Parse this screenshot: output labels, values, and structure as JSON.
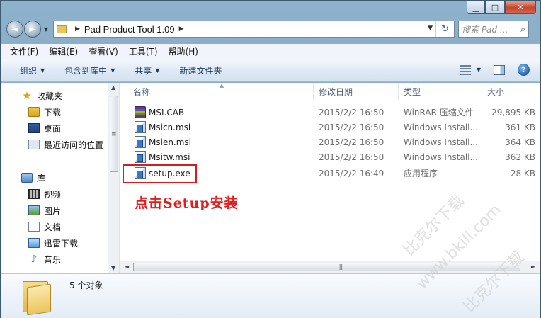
{
  "window": {
    "controls": {
      "minimize": "▁",
      "maximize": "□",
      "close": "✕"
    }
  },
  "navigation": {
    "back_symbol": "◄",
    "forward_symbol": "►",
    "history_dropdown": "▼",
    "address_path": "Pad Product Tool 1.09",
    "crumb_separator": "▶",
    "search_placeholder": "搜索 Pad ...",
    "search_symbol": "⌕",
    "refresh_symbol": "↻"
  },
  "menubar": [
    {
      "label": "文件(F)"
    },
    {
      "label": "编辑(E)"
    },
    {
      "label": "查看(V)"
    },
    {
      "label": "工具(T)"
    },
    {
      "label": "帮助(H)"
    }
  ],
  "commandbar": {
    "organize": "组织",
    "include_in_library": "包含到库中",
    "share": "共享",
    "new_folder": "新建文件夹",
    "help_label": "?"
  },
  "sidebar": {
    "favorites_header": "收藏夹",
    "favorites": [
      {
        "label": "下载"
      },
      {
        "label": "桌面"
      },
      {
        "label": "最近访问的位置"
      }
    ],
    "libraries_header": "库",
    "libraries": [
      {
        "label": "视频"
      },
      {
        "label": "图片"
      },
      {
        "label": "文档"
      },
      {
        "label": "迅雷下载"
      },
      {
        "label": "音乐"
      }
    ]
  },
  "filelist": {
    "columns": {
      "name": "名称",
      "modified": "修改日期",
      "type": "类型",
      "size": "大小"
    },
    "rows": [
      {
        "name": "MSI.CAB",
        "modified": "2015/2/2 16:50",
        "type": "WinRAR 压缩文件",
        "size": "29,895 KB",
        "icon": "rar-archive-icon"
      },
      {
        "name": "Msicn.msi",
        "modified": "2015/2/2 16:50",
        "type": "Windows Install...",
        "size": "361 KB",
        "icon": "msi-installer-icon"
      },
      {
        "name": "Msien.msi",
        "modified": "2015/2/2 16:50",
        "type": "Windows Install...",
        "size": "364 KB",
        "icon": "msi-installer-icon"
      },
      {
        "name": "Msitw.msi",
        "modified": "2015/2/2 16:50",
        "type": "Windows Install...",
        "size": "362 KB",
        "icon": "msi-installer-icon"
      },
      {
        "name": "setup.exe",
        "modified": "2015/2/2 16:49",
        "type": "应用程序",
        "size": "28 KB",
        "icon": "setup-exe-icon"
      }
    ]
  },
  "annotation": {
    "text": "点击Setup安装",
    "color": "#e21b1b"
  },
  "details": {
    "item_count": "5 个对象"
  },
  "watermarks": [
    {
      "text": "比克尔下载"
    },
    {
      "text": "www.bkill.com"
    },
    {
      "text": "比克尔下载"
    }
  ]
}
